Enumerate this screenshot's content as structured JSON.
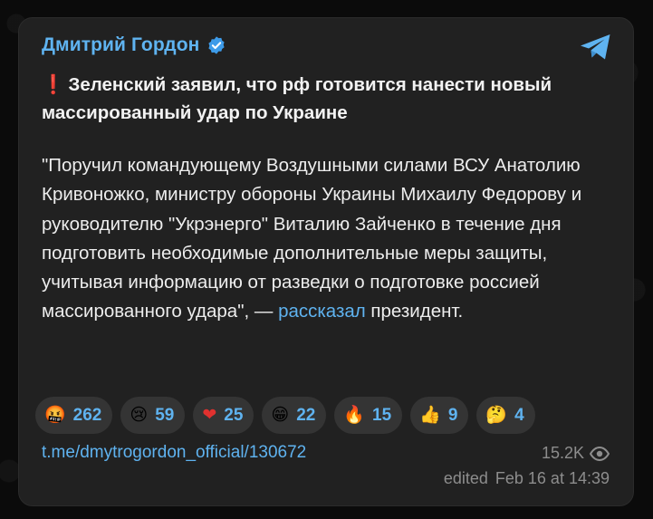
{
  "post": {
    "channel_name": "Дмитрий Гордон",
    "headline_mark": "❗",
    "headline": "Зеленский заявил, что рф готовится нанести новый массированный удар по Украине",
    "body_main": "\"Поручил командующему Воздушными силами ВСУ Анатолию Кривоножко, министру обороны Украины Михаилу Федорову и руководителю \"Укрэнерго\" Виталию Зайченко в течение дня подготовить необходимые дополнительные меры защиты, учитывая информацию от разведки о подготовке россией массированного удара\", — ",
    "body_link": "рассказал",
    "body_end": " президент.",
    "reactions": [
      {
        "emoji": "🤬",
        "count": "262"
      },
      {
        "emoji": "😢",
        "count": "59"
      },
      {
        "emoji": "❤",
        "count": "25"
      },
      {
        "emoji": "😁",
        "count": "22"
      },
      {
        "emoji": "🔥",
        "count": "15"
      },
      {
        "emoji": "👍",
        "count": "9"
      },
      {
        "emoji": "🤔",
        "count": "4"
      }
    ],
    "post_link": "t.me/dmytrogordon_official/130672",
    "views": "15.2K",
    "edited_label": "edited",
    "timestamp": "Feb 16 at 14:39"
  },
  "icons": {
    "verified": "verified-badge-icon",
    "telegram": "telegram-plane-icon",
    "eye": "eye-icon"
  },
  "colors": {
    "accent": "#5fb3f0",
    "card": "#212121",
    "background": "#0b0b0b",
    "reaction_bg": "#343434",
    "muted": "#8d8d8d",
    "exclamation": "#e0312f"
  }
}
